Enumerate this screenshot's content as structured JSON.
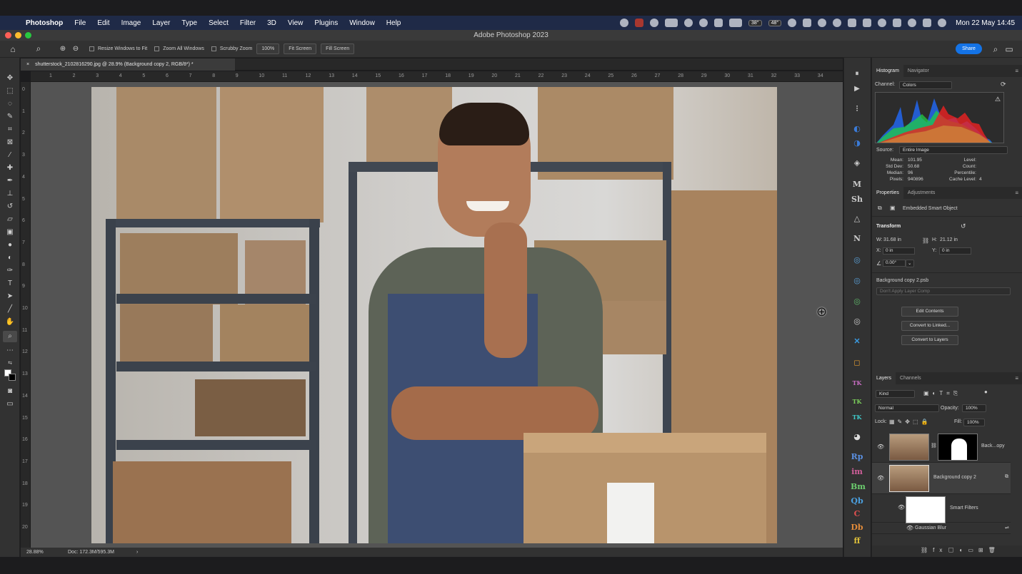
{
  "menubar": {
    "app_name": "Photoshop",
    "items": [
      "File",
      "Edit",
      "Image",
      "Layer",
      "Type",
      "Select",
      "Filter",
      "3D",
      "View",
      "Plugins",
      "Window",
      "Help"
    ],
    "temp1": "38°",
    "temp2": "48°",
    "clock": "Mon 22 May  14:45"
  },
  "window": {
    "title": "Adobe Photoshop 2023"
  },
  "options": {
    "resize_windows": "Resize Windows to Fit",
    "zoom_all": "Zoom All Windows",
    "scrubby_zoom": "Scrubby Zoom",
    "zoom_value": "100%",
    "fit_screen": "Fit Screen",
    "fill_screen": "Fill Screen",
    "share": "Share"
  },
  "document": {
    "tab_title": "shutterstock_2102816290.jpg @ 28.9% (Background copy 2, RGB/8*) *",
    "zoom": "28.88%",
    "doc_size": "Doc: 172.3M/595.3M"
  },
  "rulers": {
    "h": [
      "1",
      "2",
      "3",
      "4",
      "5",
      "6",
      "7",
      "8",
      "9",
      "10",
      "11",
      "12",
      "13",
      "14",
      "15",
      "16",
      "17",
      "18",
      "19",
      "20",
      "21",
      "22",
      "23",
      "24",
      "25",
      "26",
      "27",
      "28",
      "29",
      "30",
      "31",
      "32",
      "33",
      "34"
    ],
    "v": [
      "0",
      "1",
      "2",
      "3",
      "4",
      "5",
      "6",
      "7",
      "8",
      "9",
      "10",
      "11",
      "12",
      "13",
      "14",
      "15",
      "16",
      "17",
      "18",
      "19",
      "20"
    ]
  },
  "histogram": {
    "tabs": [
      "Histogram",
      "Navigator"
    ],
    "channel_label": "Channel:",
    "channel_value": "Colors",
    "source_label": "Source:",
    "source_value": "Entire Image",
    "stats_left": [
      {
        "label": "Mean:",
        "value": "101.95"
      },
      {
        "label": "Std Dev:",
        "value": "50.68"
      },
      {
        "label": "Median:",
        "value": "96"
      },
      {
        "label": "Pixels:",
        "value": "940896"
      }
    ],
    "stats_right": [
      {
        "label": "Level:",
        "value": ""
      },
      {
        "label": "Count:",
        "value": ""
      },
      {
        "label": "Percentile:",
        "value": ""
      },
      {
        "label": "Cache Level:",
        "value": "4"
      }
    ]
  },
  "properties": {
    "tabs": [
      "Properties",
      "Adjustments"
    ],
    "object_type": "Embedded Smart Object",
    "transform_label": "Transform",
    "w_label": "W:",
    "w_value": "31.68 in",
    "h_label": "H:",
    "h_value": "21.12 in",
    "x_label": "X:",
    "x_value": "0 in",
    "y_label": "Y:",
    "y_value": "0 in",
    "angle_value": "0.00°",
    "file_name": "Background copy 2.psb",
    "layer_comp": "Don't Apply Layer Comp",
    "edit_contents": "Edit Contents",
    "convert_linked": "Convert to Linked...",
    "convert_layers": "Convert to Layers"
  },
  "layers": {
    "tabs": [
      "Layers",
      "Channels"
    ],
    "kind": "Kind",
    "blend_mode": "Normal",
    "opacity_label": "Opacity:",
    "opacity_value": "100%",
    "lock_label": "Lock:",
    "fill_label": "Fill:",
    "fill_value": "100%",
    "items": [
      {
        "name": "Back...opy"
      },
      {
        "name": "Background copy 2"
      },
      {
        "name": "Smart Filters"
      },
      {
        "name": "Gaussian Blur"
      }
    ]
  },
  "plugins": [
    "Sh",
    "Rp",
    "im",
    "Bm",
    "Qb",
    "C",
    "Db",
    "ff"
  ],
  "colors": {
    "accent": "#1473e6",
    "menubar": "#1f2a47",
    "panel": "#323232",
    "canvas_bg": "#545454"
  }
}
